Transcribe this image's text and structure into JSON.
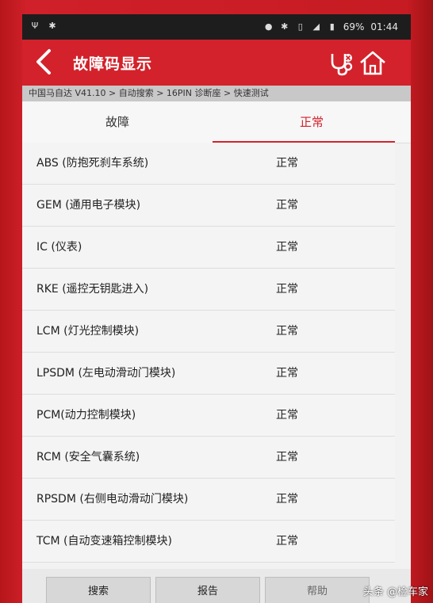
{
  "status_bar": {
    "battery": "69%",
    "time": "01:44"
  },
  "header": {
    "title": "故障码显示"
  },
  "breadcrumb": "中国马自达 V41.10 > 自动搜索 > 16PIN 诊断座 > 快速测试",
  "tabs": {
    "fault": "故障",
    "normal": "正常"
  },
  "rows": [
    {
      "name": "ABS (防抱死刹车系统)",
      "status": "正常"
    },
    {
      "name": "GEM (通用电子模块)",
      "status": "正常"
    },
    {
      "name": "IC (仪表)",
      "status": "正常"
    },
    {
      "name": "RKE (遥控无钥匙进入)",
      "status": "正常"
    },
    {
      "name": "LCM (灯光控制模块)",
      "status": "正常"
    },
    {
      "name": "LPSDM (左电动滑动门模块)",
      "status": "正常"
    },
    {
      "name": "PCM(动力控制模块)",
      "status": "正常"
    },
    {
      "name": "RCM (安全气囊系统)",
      "status": "正常"
    },
    {
      "name": "RPSDM (右侧电动滑动门模块)",
      "status": "正常"
    },
    {
      "name": "TCM (自动变速箱控制模块)",
      "status": "正常"
    }
  ],
  "buttons": {
    "search": "搜索",
    "report": "报告",
    "help": "帮助"
  },
  "watermark": "头条 @检车家",
  "colors": {
    "accent": "#d3222b",
    "statusbar": "#1d1d1d"
  }
}
